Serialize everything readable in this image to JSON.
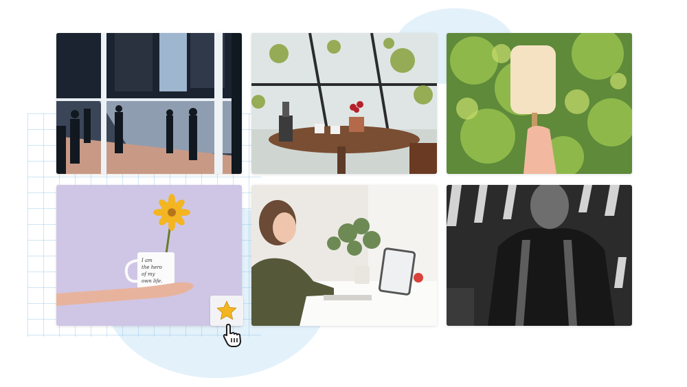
{
  "gallery": {
    "items": [
      {
        "icon": "city-window-photo"
      },
      {
        "icon": "cafe-table-photo"
      },
      {
        "icon": "popsicle-photo"
      },
      {
        "icon": "flower-mug-photo",
        "mug_text": [
          "I am",
          "the hero",
          "of my",
          "own life."
        ]
      },
      {
        "icon": "woman-desk-photo"
      },
      {
        "icon": "man-shadows-photo"
      }
    ]
  },
  "favorite": {
    "icon": "star-icon",
    "color": "#f3b521"
  },
  "cursor": {
    "icon": "hand-pointer-icon"
  },
  "colors": {
    "accent_bg": "#e3f1fa",
    "grid": "#78b4e1",
    "lavender": "#cfc6e6"
  }
}
